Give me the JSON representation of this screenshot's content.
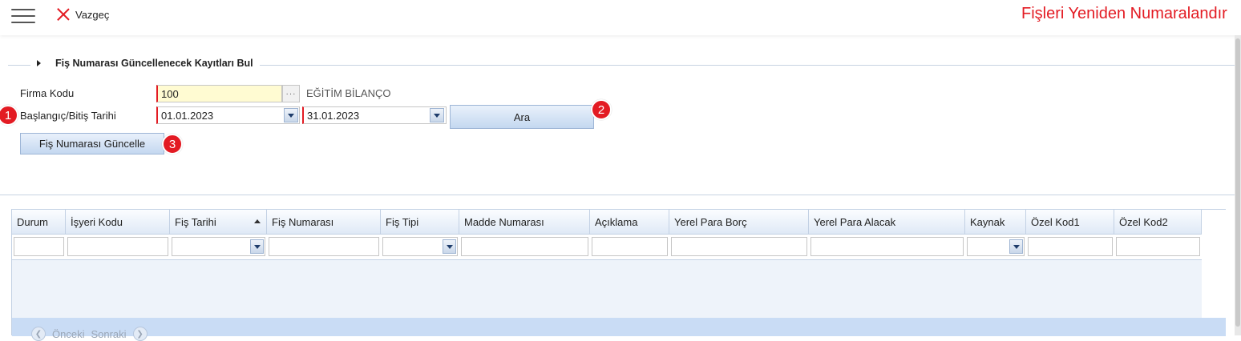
{
  "topbar": {
    "menu_icon": "hamburger-menu-icon",
    "cancel_label": "Vazgeç",
    "cancel_icon": "close-x-icon",
    "title": "Fişleri Yeniden Numaralandır",
    "title_color": "#e31b23"
  },
  "section": {
    "title": "Fiş Numarası Güncellenecek Kayıtları Bul",
    "toggle_icon": "triangle-right-icon"
  },
  "form": {
    "company_label": "Firma Kodu",
    "company_value": "100",
    "company_name": "EĞİTİM BİLANÇO",
    "lookup_label": "···",
    "date_label": "Başlangıç/Bitiş Tarihi",
    "start_date": "01.01.2023",
    "end_date": "31.01.2023",
    "search_button": "Ara",
    "update_button": "Fiş Numarası Güncelle"
  },
  "badges": [
    "1",
    "2",
    "3"
  ],
  "grid": {
    "columns": [
      {
        "label": "Durum"
      },
      {
        "label": "İşyeri Kodu"
      },
      {
        "label": "Fiş Tarihi"
      },
      {
        "label": "Fiş Numarası"
      },
      {
        "label": "Fiş Tipi"
      },
      {
        "label": "Madde Numarası"
      },
      {
        "label": "Açıklama"
      },
      {
        "label": "Yerel Para Borç"
      },
      {
        "label": "Yerel Para Alacak"
      },
      {
        "label": "Kaynak"
      },
      {
        "label": "Özel Kod1"
      },
      {
        "label": "Özel Kod2"
      }
    ],
    "sorted_column": "Fiş Tarihi",
    "sort_direction": "ascending",
    "pager": {
      "prev": "Önceki",
      "next": "Sonraki"
    }
  },
  "colors": {
    "accent": "#e31b23",
    "header_bg": "#dfe9f6",
    "button_bg": "#c4d8f0"
  }
}
